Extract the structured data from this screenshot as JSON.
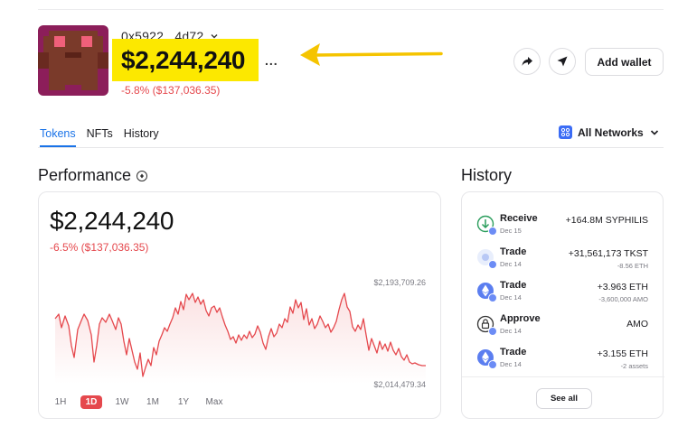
{
  "wallet": {
    "address": "0x5922...4d72",
    "balance": "$2,244,240",
    "more_label": "...",
    "change": "-5.8% ($137,036.35)"
  },
  "actions": {
    "add_wallet_label": "Add wallet"
  },
  "tabs": [
    {
      "label": "Tokens",
      "active": true
    },
    {
      "label": "NFTs",
      "active": false
    },
    {
      "label": "History",
      "active": false
    }
  ],
  "networks": {
    "label": "All Networks"
  },
  "performance": {
    "title": "Performance",
    "value": "$2,244,240",
    "change": "-6.5% ($137,036.35)",
    "high_label": "$2,193,709.26",
    "low_label": "$2,014,479.34",
    "ranges": [
      {
        "label": "1H",
        "active": false
      },
      {
        "label": "1D",
        "active": true
      },
      {
        "label": "1W",
        "active": false
      },
      {
        "label": "1M",
        "active": false
      },
      {
        "label": "1Y",
        "active": false
      },
      {
        "label": "Max",
        "active": false
      }
    ]
  },
  "history": {
    "title": "History",
    "see_all_label": "See all",
    "items": [
      {
        "label": "Receive",
        "date": "Dec 15",
        "amount": "+164.8M SYPHILIS",
        "sub": "",
        "icon": "receive-icon"
      },
      {
        "label": "Trade",
        "date": "Dec 14",
        "amount": "+31,561,173 TKST",
        "sub": "-8.56 ETH",
        "icon": "trade-icon"
      },
      {
        "label": "Trade",
        "date": "Dec 14",
        "amount": "+3.963 ETH",
        "sub": "-3,600,000 AMO",
        "icon": "eth-icon"
      },
      {
        "label": "Approve",
        "date": "Dec 14",
        "amount": "AMO",
        "sub": "",
        "icon": "approve-icon"
      },
      {
        "label": "Trade",
        "date": "Dec 14",
        "amount": "+3.155 ETH",
        "sub": "-2 assets",
        "icon": "eth-icon"
      }
    ]
  },
  "colors": {
    "accent": "#1a73e8",
    "negative": "#e5484d",
    "highlight": "#fce800",
    "arrow": "#f5c400"
  }
}
